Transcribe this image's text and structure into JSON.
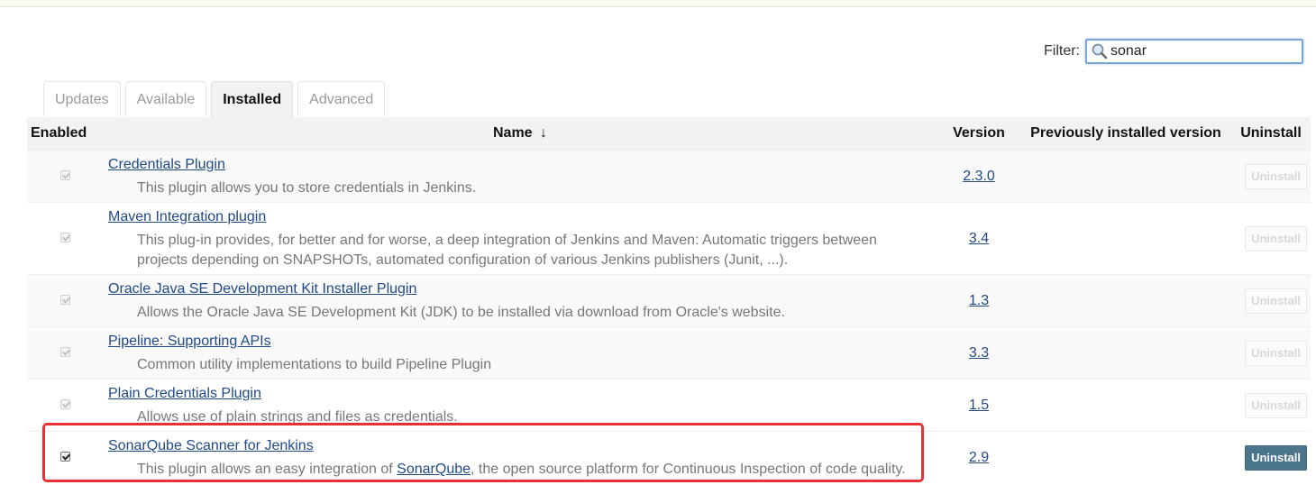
{
  "filter": {
    "label": "Filter:",
    "value": "sonar"
  },
  "tabs": [
    {
      "label": "Updates",
      "active": false
    },
    {
      "label": "Available",
      "active": false
    },
    {
      "label": "Installed",
      "active": true
    },
    {
      "label": "Advanced",
      "active": false
    }
  ],
  "table": {
    "headers": {
      "enabled": "Enabled",
      "name": "Name",
      "sort_indicator": "↓",
      "version": "Version",
      "previous": "Previously installed version",
      "uninstall": "Uninstall"
    },
    "rows": [
      {
        "name": "Credentials Plugin",
        "description": "This plugin allows you to store credentials in Jenkins.",
        "version": "2.3.0",
        "enabled": true,
        "checkbox_disabled": true,
        "uninstall_label": "Uninstall",
        "uninstall_enabled": false
      },
      {
        "name": "Maven Integration plugin",
        "description": "This plug-in provides, for better and for worse, a deep integration of Jenkins and Maven: Automatic triggers between projects depending on SNAPSHOTs, automated configuration of various Jenkins publishers (Junit, ...).",
        "version": "3.4",
        "enabled": true,
        "checkbox_disabled": true,
        "uninstall_label": "Uninstall",
        "uninstall_enabled": false
      },
      {
        "name": "Oracle Java SE Development Kit Installer Plugin",
        "description": "Allows the Oracle Java SE Development Kit (JDK) to be installed via download from Oracle's website.",
        "version": "1.3",
        "enabled": true,
        "checkbox_disabled": true,
        "uninstall_label": "Uninstall",
        "uninstall_enabled": false
      },
      {
        "name": "Pipeline: Supporting APIs",
        "description": "Common utility implementations to build Pipeline Plugin",
        "version": "3.3",
        "enabled": true,
        "checkbox_disabled": true,
        "uninstall_label": "Uninstall",
        "uninstall_enabled": false
      },
      {
        "name": "Plain Credentials Plugin",
        "description": "Allows use of plain strings and files as credentials.",
        "version": "1.5",
        "enabled": true,
        "checkbox_disabled": true,
        "uninstall_label": "Uninstall",
        "uninstall_enabled": false
      },
      {
        "name": "SonarQube Scanner for Jenkins",
        "description_parts": {
          "before": "This plugin allows an easy integration of ",
          "link": "SonarQube",
          "after": ", the open source platform for Continuous Inspection of code quality."
        },
        "version": "2.9",
        "enabled": true,
        "checkbox_disabled": false,
        "uninstall_label": "Uninstall",
        "uninstall_enabled": true
      }
    ]
  },
  "colors": {
    "link": "#204a87",
    "uninstall_active_bg": "#4b758b",
    "highlight_border": "#e63232",
    "header_bg": "#f2f2f2"
  }
}
